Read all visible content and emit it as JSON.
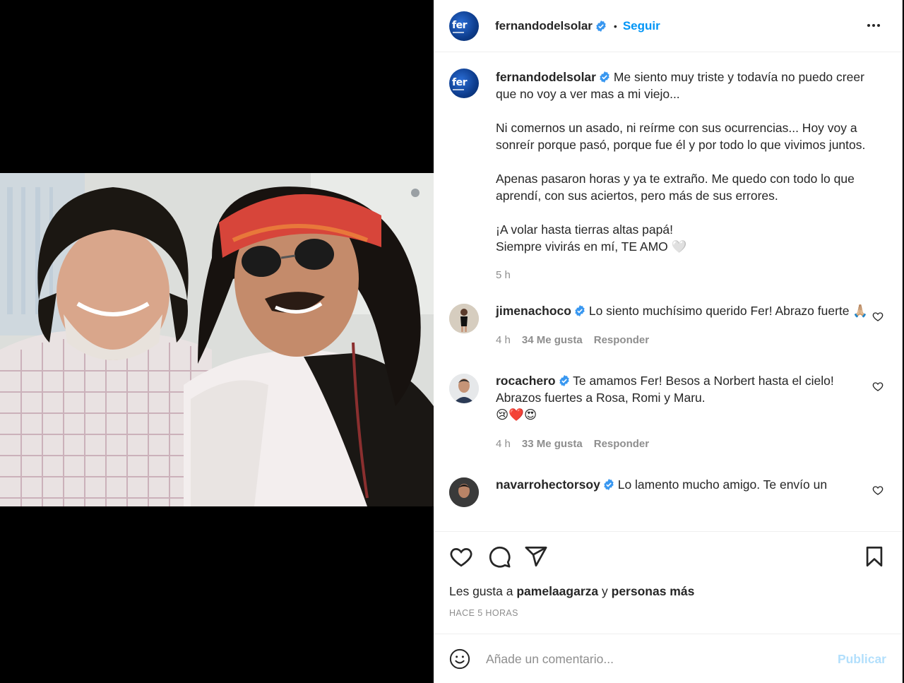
{
  "post": {
    "author": "fernandodelsolar",
    "follow_label": "Seguir",
    "separator": "•",
    "avatar_text": "fer"
  },
  "caption": {
    "username": "fernandodelsolar",
    "text": "Me siento muy triste y todavía no puedo creer que no voy a ver mas a mi viejo...\n\nNi comernos un asado, ni reírme con sus ocurrencias... Hoy voy a sonreír porque pasó, porque fue él y por todo lo que vivimos juntos.\n\nApenas pasaron horas y ya te extraño. Me quedo con todo lo que aprendí, con sus aciertos, pero más de sus errores.\n\n¡A volar hasta tierras altas papá!\nSiempre vivirás en mí, TE AMO 🤍",
    "time": "5 h"
  },
  "comments": [
    {
      "username": "jimenachoco",
      "text": "Lo siento muchísimo querido Fer! Abrazo fuerte 🙏🏼",
      "time": "4 h",
      "likes": "34 Me gusta",
      "reply": "Responder"
    },
    {
      "username": "rocachero",
      "text": "Te amamos Fer! Besos a Norbert hasta el cielo! Abrazos fuertes a Rosa, Romi y Maru.\n😢❤️😍",
      "time": "4 h",
      "likes": "33 Me gusta",
      "reply": "Responder"
    },
    {
      "username": "navarrohectorsoy",
      "text": "Lo lamento mucho amigo. Te envío un"
    }
  ],
  "likes": {
    "prefix": "Les gusta a",
    "user": "pamelaagarza",
    "conj": "y",
    "others": "personas más"
  },
  "timestamp": "HACE 5 HORAS",
  "comment_box": {
    "placeholder": "Añade un comentario...",
    "publish": "Publicar"
  },
  "colors": {
    "link": "#0095f6",
    "verified": "#3897f0",
    "muted": "#8e8e8e",
    "publish_disabled": "#b2dffc"
  }
}
